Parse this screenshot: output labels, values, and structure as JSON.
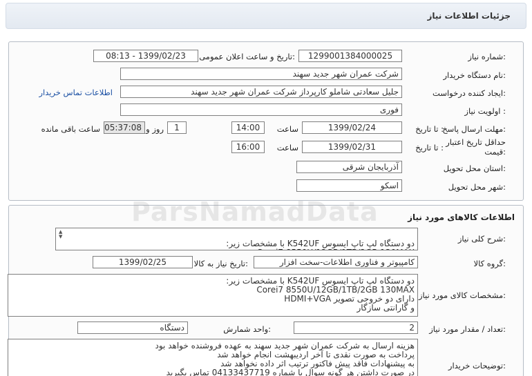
{
  "header": {
    "title": "جزئیات اطلاعات نیاز"
  },
  "need_info": {
    "need_number_label": "شماره نیاز:",
    "need_number": "1299001384000025",
    "announce_label": "تاریخ و ساعت اعلان عمومی:",
    "announce_value": "1399/02/23 - 08:13",
    "buyer_org_label": "نام دستگاه خریدار:",
    "buyer_org": "شرکت عمران شهر جدید سهند",
    "creator_label": "ایجاد کننده درخواست:",
    "creator": "جلیل سعادتی شاملو کارپرداز شرکت عمران شهر جدید سهند",
    "contact_link": "اطلاعات تماس خریدار",
    "priority_label": "اولویت نیاز :",
    "priority": "فوری",
    "deadline_label": "مهلت ارسال پاسخ:",
    "deadline_to": "تا تاریخ :",
    "deadline_date": "1399/02/24",
    "time_label": "ساعت",
    "deadline_time": "14:00",
    "days_value": "1",
    "days_label": "روز و",
    "remaining_value": "05:37:08",
    "remaining_label": "ساعت باقی مانده",
    "validity_label": "حداقل تاریخ اعتبار قیمت:",
    "validity_to": "تا تاریخ :",
    "validity_date": "1399/02/31",
    "validity_time": "16:00",
    "province_label": "استان محل تحویل:",
    "province": "آذربایجان شرقی",
    "city_label": "شهر محل تحویل:",
    "city": "اسکو"
  },
  "goods": {
    "title": "اطلاعات کالاهای مورد نیاز",
    "summary_label": "شرح کلی نیاز:",
    "summary": "دو دستگاه لپ تاپ ایسوس K542UF با مشخصات زیر:\nCorei7 8550U/12GB/1TB/2GB 130MAX",
    "group_label": "گروه کالا:",
    "group": "کامپیوتر و فناوری اطلاعات-سخت افزار",
    "need_date_label": "تاریخ نیاز به کالا:",
    "need_date": "1399/02/25",
    "spec_label": "مشخصات کالای مورد نیاز:",
    "spec": "دو دستگاه لپ تاپ ایسوس K542UF با مشخصات زیر:\nCorei7 8550U/12GB/1TB/2GB 130MAX\nدارای دو خروجی تصویر HDMI+VGA\nو گارانتی سازگار",
    "quantity_label": "تعداد / مقدار مورد نیاز:",
    "quantity": "2",
    "unit_label": "واحد شمارش:",
    "unit": "دستگاه",
    "notes_label": "توضیحات خریدار:",
    "notes": "هزینه ارسال به شرکت عمران شهر جدید سهند به عهده فروشنده خواهد بود\nپرداخت به صورت نقدی تا آخر اردیبهشت انجام خواهد شد\nبه پیشنهادات فاقد پیش فاکتور ترتیب اثر داده نخواهد شد\nدر صورت داشتن هر گونه سوال با شماره 04133437719 تماس بگیرید"
  },
  "watermark": "ParsNamadData"
}
